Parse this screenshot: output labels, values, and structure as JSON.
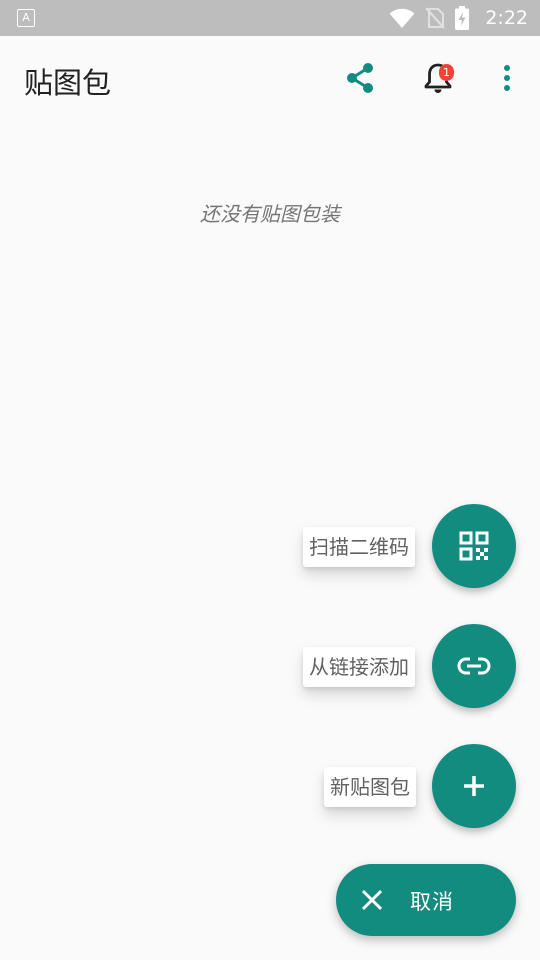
{
  "status_bar": {
    "left_icon_glyph": "A",
    "time": "2:22",
    "icons": [
      "wifi-icon",
      "no-sim-icon",
      "battery-charging-icon"
    ]
  },
  "app_bar": {
    "title": "贴图包",
    "notification_count": "1",
    "icons": [
      "share-icon",
      "bell-icon",
      "more-vert-icon"
    ]
  },
  "main": {
    "empty_message": "还没有贴图包装"
  },
  "fab_menu": {
    "items": [
      {
        "label": "扫描二维码",
        "icon": "qr-code-icon"
      },
      {
        "label": "从链接添加",
        "icon": "link-icon"
      },
      {
        "label": "新贴图包",
        "icon": "plus-icon"
      }
    ],
    "cancel_label": "取消"
  },
  "colors": {
    "accent": "#138c80",
    "badge": "#f44336",
    "status_bar": "#bdbdbd"
  }
}
